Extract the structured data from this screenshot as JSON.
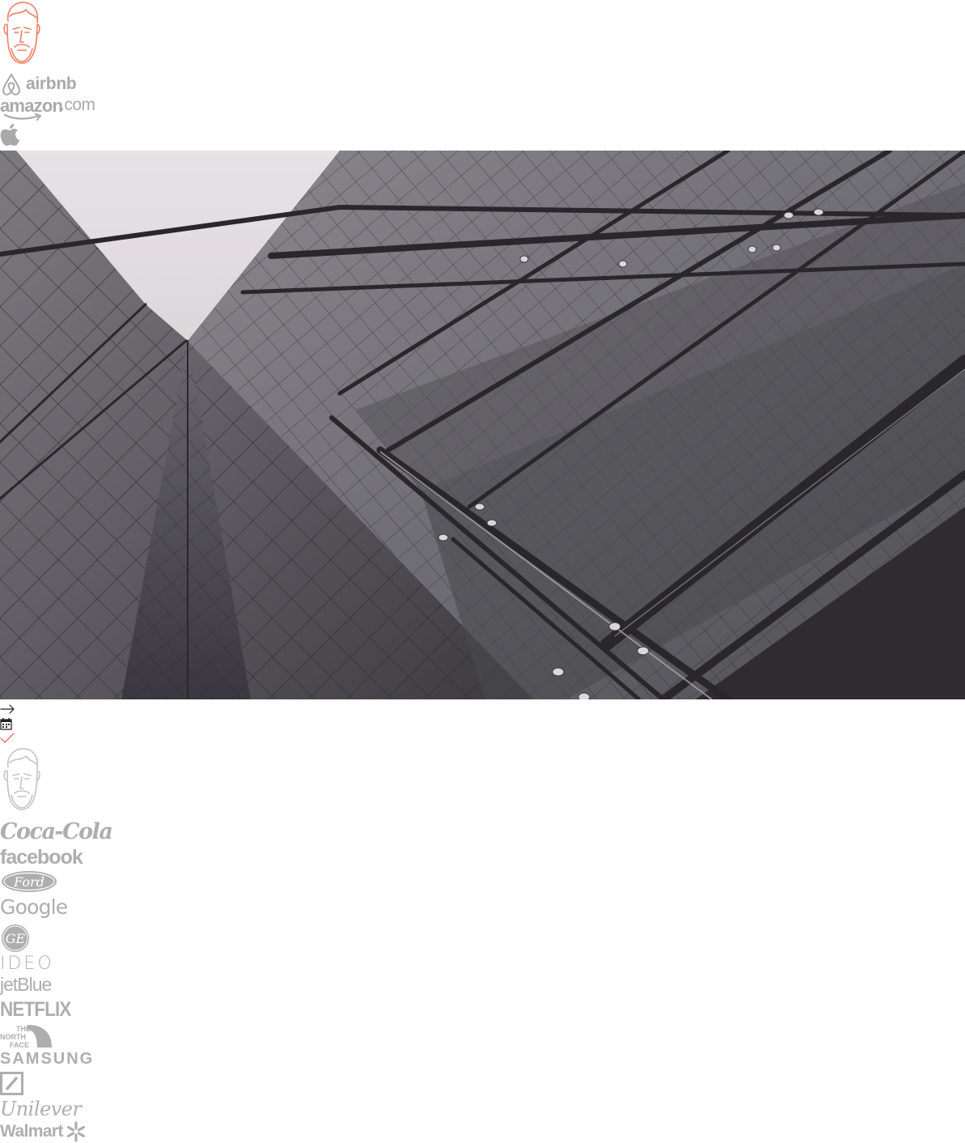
{
  "brand": {
    "top_mascot": "bearded-man-illustration",
    "bottom_mascot": "bearded-man-illustration",
    "accent_color": "#f07e63"
  },
  "logos_top": {
    "airbnb": "airbnb",
    "amazon_word": "amazon",
    "amazon_tld": ".com",
    "apple": "apple-icon"
  },
  "hero": {
    "image": "glass-skyscraper-photo"
  },
  "icons": {
    "arrow": "arrow-right-icon",
    "calendar": "calendar-icon",
    "check": "check-icon"
  },
  "client_logos": {
    "coca_cola": "Coca-Cola",
    "facebook": "facebook",
    "ford": "Ford",
    "google": "Google",
    "ge": "GE",
    "ideo": "IDEO",
    "jetblue": "jetBlue",
    "netflix": "NETFLIX",
    "northface_1": "THE",
    "northface_2": "NORTH",
    "northface_3": "FACE",
    "samsung": "SAMSUNG",
    "deutsche": "deutsche-bank-icon",
    "unilever": "Unilever",
    "walmart": "Walmart"
  },
  "colors": {
    "logo_gray": "#a9a9a9",
    "check_red": "#e2574c"
  }
}
